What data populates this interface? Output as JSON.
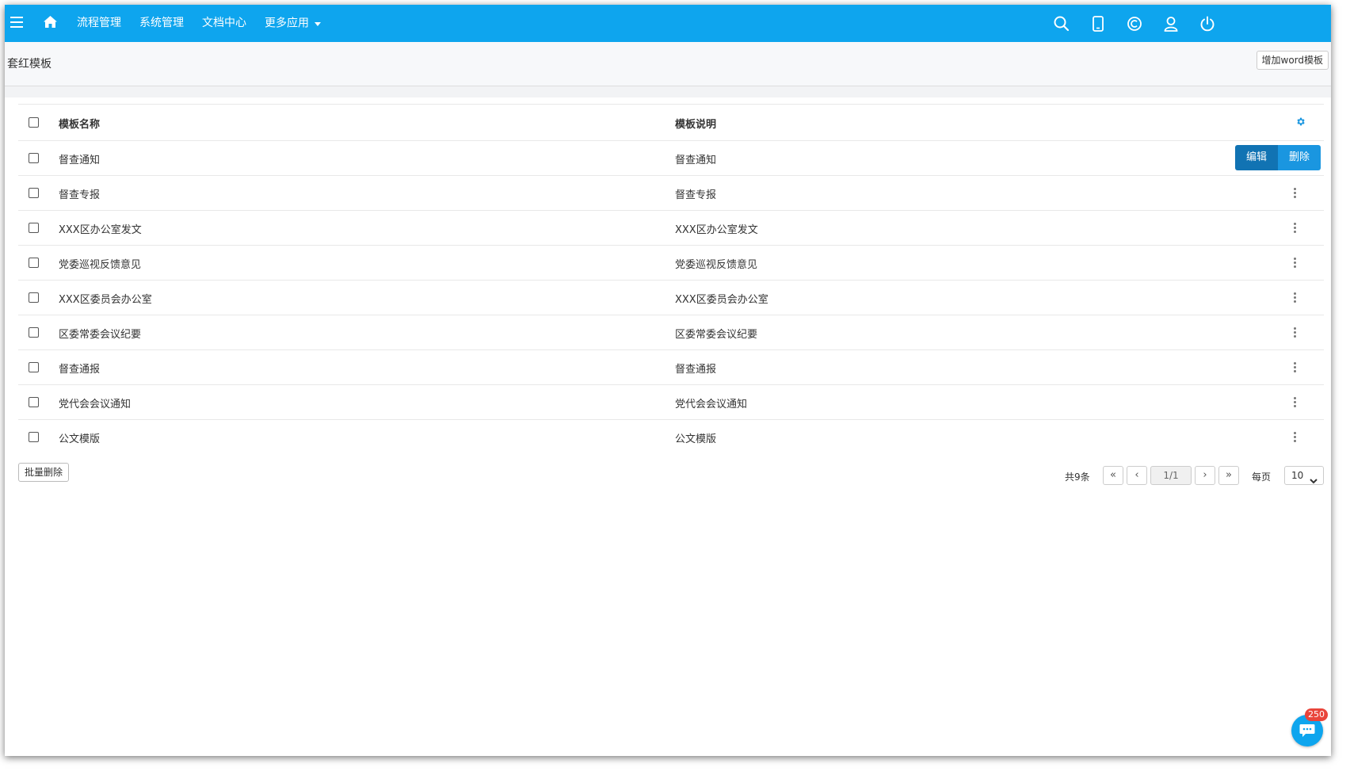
{
  "nav": {
    "menu_icon": "hamburger-icon",
    "home_icon": "home-icon",
    "items": [
      {
        "label": "流程管理"
      },
      {
        "label": "系统管理"
      },
      {
        "label": "文档中心"
      },
      {
        "label": "更多应用"
      }
    ],
    "right_icons": [
      "search-icon",
      "tablet-icon",
      "copyright-icon",
      "user-icon",
      "power-icon"
    ],
    "bar_color": "#0ea5ee"
  },
  "page": {
    "title": "套红模板",
    "add_button": "增加word模板"
  },
  "table": {
    "columns": [
      "模板名称",
      "模板说明"
    ],
    "settings_icon": "gear-icon",
    "rows": [
      {
        "name": "督查通知",
        "desc": "督查通知"
      },
      {
        "name": "督查专报",
        "desc": "督查专报"
      },
      {
        "name": "XXX区办公室发文",
        "desc": "XXX区办公室发文"
      },
      {
        "name": "党委巡视反馈意见",
        "desc": "党委巡视反馈意见"
      },
      {
        "name": "XXX区委员会办公室",
        "desc": "XXX区委员会办公室"
      },
      {
        "name": "区委常委会议纪要",
        "desc": "区委常委会议纪要"
      },
      {
        "name": "督查通报",
        "desc": "督查通报"
      },
      {
        "name": "党代会会议通知",
        "desc": "党代会会议通知"
      },
      {
        "name": "公文模版",
        "desc": "公文模版"
      }
    ],
    "row_actions": {
      "edit": "编辑",
      "delete": "删除"
    }
  },
  "footer": {
    "batch_delete": "批量删除",
    "total": "共9条",
    "first": "«",
    "prev": "‹",
    "page": "1/1",
    "next": "›",
    "last": "»",
    "per_page_label": "每页",
    "per_page": "10"
  },
  "chat": {
    "icon": "chat-bubble-icon",
    "badge": "250"
  }
}
